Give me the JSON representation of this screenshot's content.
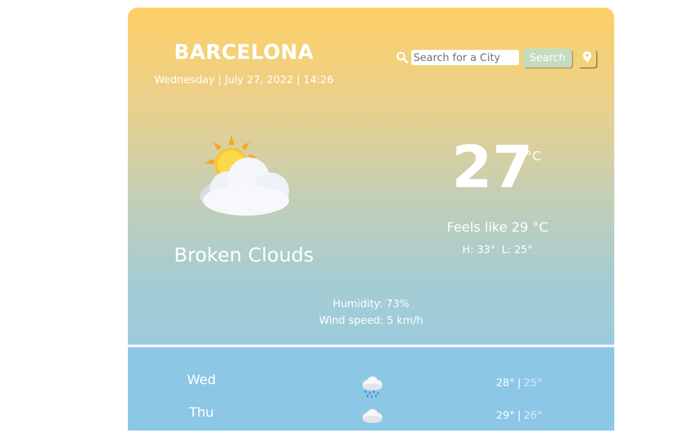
{
  "header": {
    "city": "BARCELONA",
    "datetime": "Wednesday | July 27, 2022 | 14:26"
  },
  "search": {
    "icon": "search-icon",
    "placeholder": "Search for a City",
    "button_label": "Search",
    "location_icon": "map-marker-icon"
  },
  "current": {
    "icon": "sun-behind-cloud-icon",
    "condition": "Broken Clouds",
    "temperature": "27",
    "unit": "°C",
    "feels_like": "Feels like 29 °C",
    "high": "H: 33°",
    "low": "L: 25°",
    "humidity": "Humidity: 73%",
    "wind": "Wind speed: 5 km/h"
  },
  "forecast": [
    {
      "day": "Wed",
      "icon": "rain-cloud-icon",
      "high": "28°",
      "low": "25°"
    },
    {
      "day": "Thu",
      "icon": "rain-cloud-icon",
      "high": "29°",
      "low": "26°"
    }
  ],
  "colors": {
    "gradient_top": "#fed066",
    "gradient_bottom": "#9ccbdc",
    "forecast_bg": "#8cc7e6",
    "search_button": "#c6dcc0",
    "location_button": "#f3d377"
  }
}
